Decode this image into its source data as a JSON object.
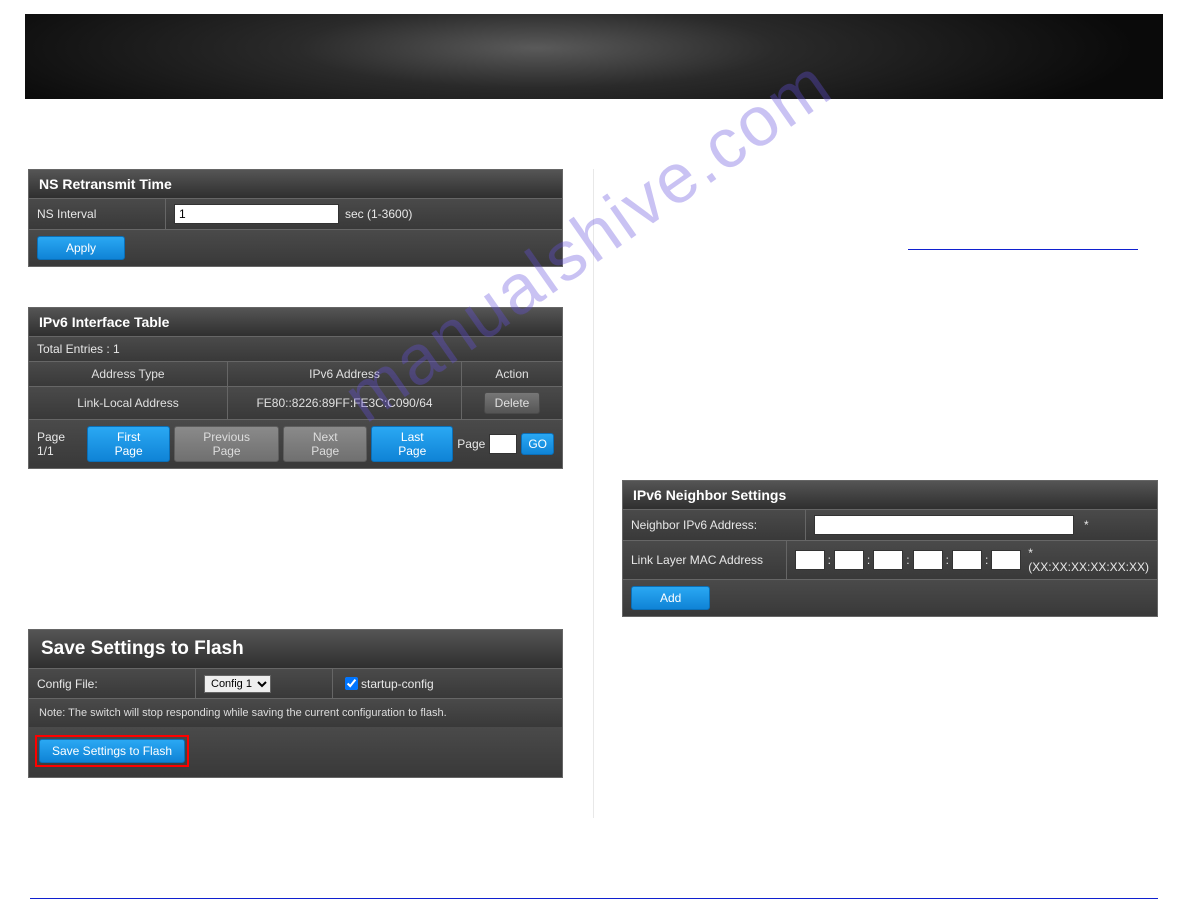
{
  "watermark": "manualshive.com",
  "ns_retransmit": {
    "title": "NS Retransmit Time",
    "label": "NS Interval",
    "value": "1",
    "hint": "sec (1-3600)",
    "apply": "Apply"
  },
  "iface_table": {
    "title": "IPv6 Interface Table",
    "total": "Total Entries : 1",
    "cols": {
      "c1": "Address Type",
      "c2": "IPv6 Address",
      "c3": "Action"
    },
    "row": {
      "c1": "Link-Local Address",
      "c2": "FE80::8226:89FF:FE3C:C090/64",
      "c3": "Delete"
    },
    "pager": {
      "page": "Page 1/1",
      "first": "First Page",
      "prev": "Previous Page",
      "next": "Next Page",
      "last": "Last Page",
      "page_lbl": "Page",
      "go": "GO"
    }
  },
  "save_flash": {
    "title": "Save Settings to Flash",
    "config_label": "Config File:",
    "config_value": "Config 1",
    "startup_label": "startup-config",
    "note": "Note: The switch will stop responding while saving the current configuration to flash.",
    "button": "Save Settings to Flash"
  },
  "neighbor": {
    "title": "IPv6 Neighbor Settings",
    "addr_label": "Neighbor IPv6 Address:",
    "asterisk": "*",
    "mac_label": "Link Layer MAC Address",
    "mac_hint": "* (XX:XX:XX:XX:XX:XX)",
    "sep": ":",
    "add": "Add"
  }
}
